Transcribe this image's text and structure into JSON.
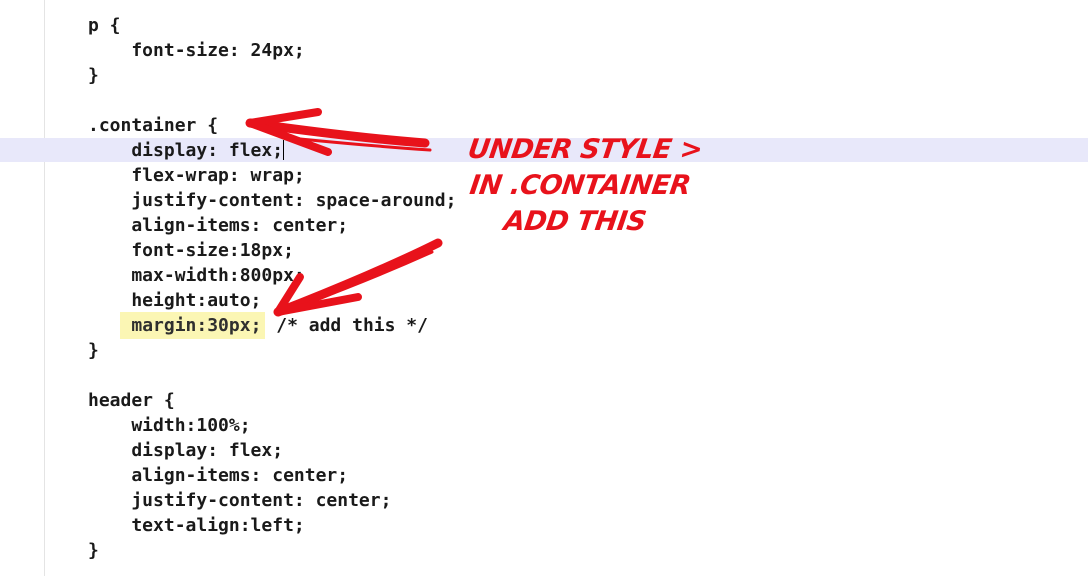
{
  "code_lines": [
    {
      "text": "p {"
    },
    {
      "text": "    font-size: 24px;"
    },
    {
      "text": "}"
    },
    {
      "text": ""
    },
    {
      "text": ".container {"
    },
    {
      "text": "    display: flex;",
      "caret": true
    },
    {
      "text": "    flex-wrap: wrap;"
    },
    {
      "text": "    justify-content: space-around;"
    },
    {
      "text": "    align-items: center;"
    },
    {
      "text": "    font-size:18px;"
    },
    {
      "text": "    max-width:800px;"
    },
    {
      "text": "    height:auto;"
    },
    {
      "text": "    ",
      "highlight": "margin:30px;",
      "after": " /* add this */"
    },
    {
      "text": "}"
    },
    {
      "text": ""
    },
    {
      "text": "header {"
    },
    {
      "text": "    width:100%;"
    },
    {
      "text": "    display: flex;"
    },
    {
      "text": "    align-items: center;"
    },
    {
      "text": "    justify-content: center;"
    },
    {
      "text": "    text-align:left;"
    },
    {
      "text": "}"
    }
  ],
  "annotation": {
    "lines": [
      "UNDER STYLE >",
      "IN .CONTAINER",
      "ADD THIS"
    ],
    "color": "#e8121b"
  },
  "colors": {
    "current_line": "#e8e8fa",
    "highlight": "#fbf6b4"
  }
}
